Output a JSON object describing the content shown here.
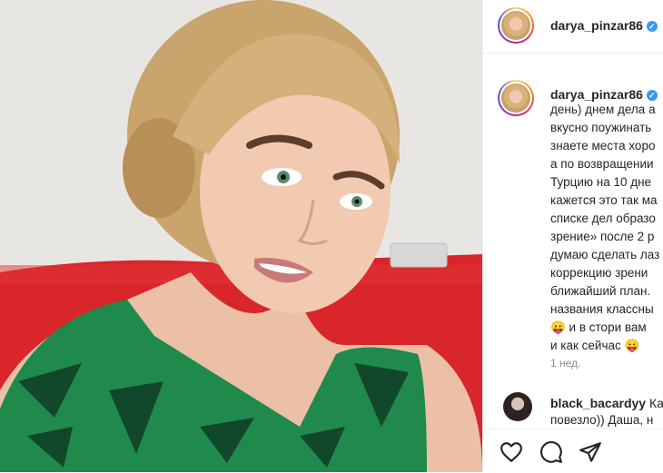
{
  "post": {
    "username": "darya_pinzar86",
    "verified_mark": "✓",
    "caption_lines": [
      "день) днем дела а",
      "вкусно поужинать",
      "знаете места хоро",
      "а по возвращении",
      "Турцию на 10 дне",
      "кажется это так ма",
      "списке дел образо",
      "зрение» после 2 р",
      "думаю сделать лаз",
      "коррекцию зрени",
      "ближайший план.",
      "названия классны",
      "😛 и в стори вам",
      "и как сейчас 😛"
    ],
    "time_ago": "1 нед."
  },
  "comments": [
    {
      "username": "black_bacardyy",
      "text_start": "Ка",
      "text_line2": "повезло)) Даша, н"
    }
  ],
  "actions": {
    "like_icon": "heart-icon",
    "comment_icon": "comment-bubble-icon",
    "share_icon": "paper-plane-icon"
  },
  "colors": {
    "text": "#262626",
    "muted": "#8e8e8e",
    "verified": "#3897f0",
    "sofa": "#d8262a",
    "dress": "#1f8a4c"
  }
}
